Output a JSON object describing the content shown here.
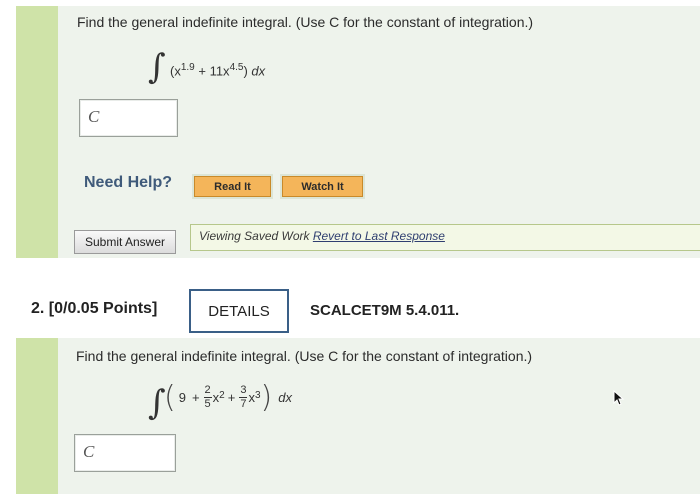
{
  "question1": {
    "prompt": "Find the general indefinite integral. (Use C for the constant of integration.)",
    "integrand": {
      "term1_base": "x",
      "term1_exp": "1.9",
      "plus": " + 11x",
      "term2_exp": "4.5",
      "dx": "dx"
    },
    "answer_placeholder": "C",
    "need_help_label": "Need Help?",
    "read_it_label": "Read It",
    "watch_it_label": "Watch It",
    "submit_label": "Submit Answer",
    "saved_text": "Viewing Saved Work",
    "revert_text": "Revert to Last Response"
  },
  "question2": {
    "number_label": "2.  [0/0.05 Points]",
    "details_label": "DETAILS",
    "course_code": "SCALCET9M 5.4.011.",
    "prompt": "Find the general indefinite integral. (Use C for the constant of integration.)",
    "integrand": {
      "const": "9",
      "frac1_num": "2",
      "frac1_den": "5",
      "term1": "x",
      "term1_exp": "2",
      "frac2_num": "3",
      "frac2_den": "7",
      "term2": "x",
      "term2_exp": "3",
      "dx": "dx"
    },
    "answer_placeholder": "C"
  },
  "icons": {
    "cursor": "mouse-pointer-icon"
  },
  "colors": {
    "accent_green": "#cfe3a8",
    "panel_bg": "#eef3ec",
    "help_button": "#f4b55a",
    "details_border": "#3a5f87"
  }
}
